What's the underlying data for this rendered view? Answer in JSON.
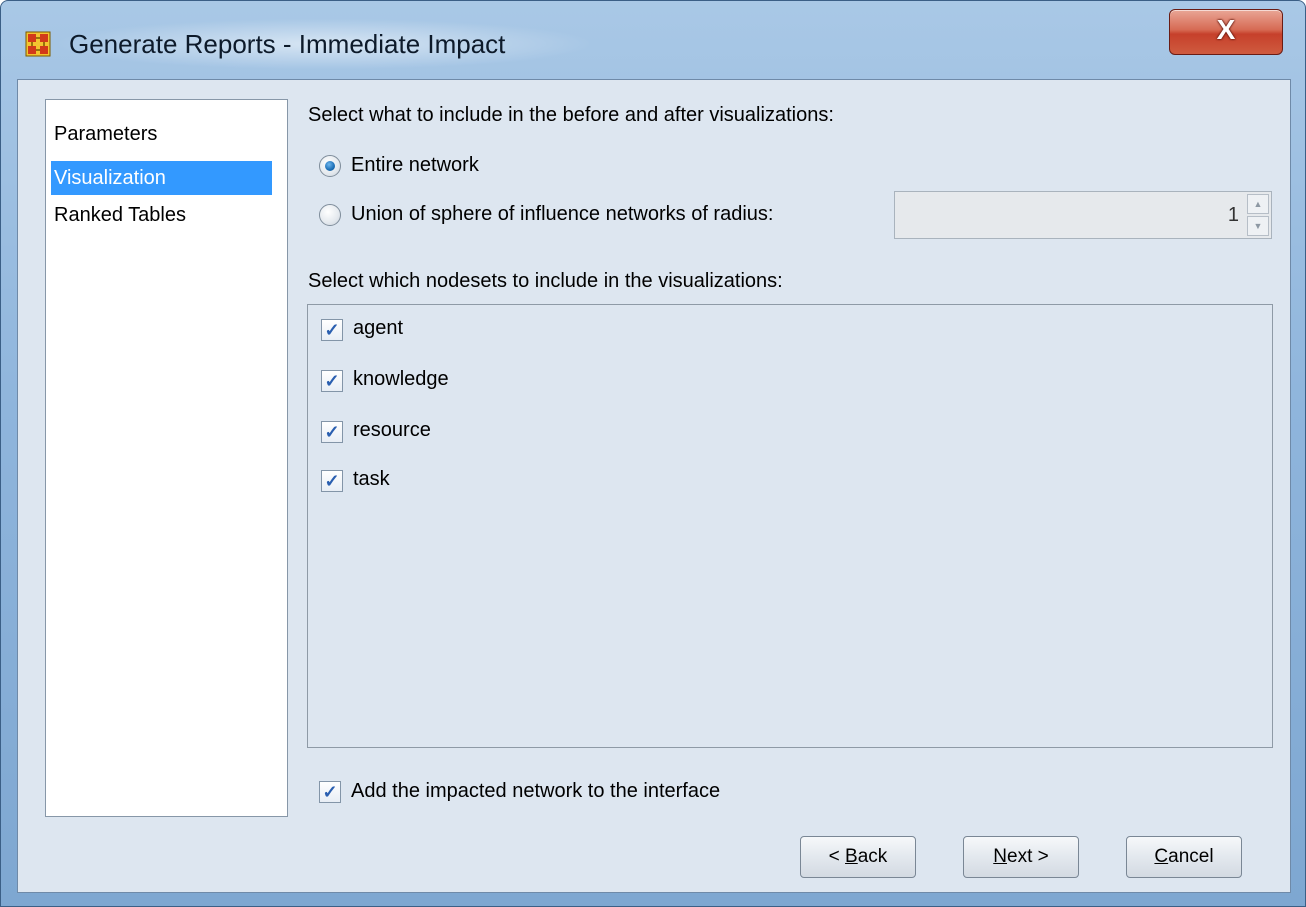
{
  "window": {
    "title": "Generate Reports - Immediate Impact",
    "close_label": "X"
  },
  "nav": {
    "items": [
      {
        "label": "Parameters",
        "selected": false
      },
      {
        "label": "Visualization",
        "selected": true
      },
      {
        "label": "Ranked Tables",
        "selected": false
      }
    ]
  },
  "visualization": {
    "include_prompt": "Select what to include in the before and after visualizations:",
    "option_entire": "Entire network",
    "option_union": "Union of sphere of influence networks of radius:",
    "selected_option": "entire",
    "radius_value": "1",
    "nodesets_prompt": "Select which nodesets to include in the visualizations:",
    "nodesets": [
      {
        "label": "agent",
        "checked": true
      },
      {
        "label": "knowledge",
        "checked": true
      },
      {
        "label": "resource",
        "checked": true
      },
      {
        "label": "task",
        "checked": true
      }
    ],
    "add_network_label": "Add the impacted network to the interface",
    "add_network_checked": true
  },
  "buttons": {
    "back": {
      "prefix": "< ",
      "mnemonic": "B",
      "rest": "ack"
    },
    "next": {
      "prefix": "",
      "mnemonic": "N",
      "rest": "ext >"
    },
    "cancel": {
      "prefix": "",
      "mnemonic": "C",
      "rest": "ancel"
    }
  },
  "colors": {
    "selection": "#3399ff",
    "panel_background": "#dde6f0",
    "close_button": "#c6402b"
  }
}
